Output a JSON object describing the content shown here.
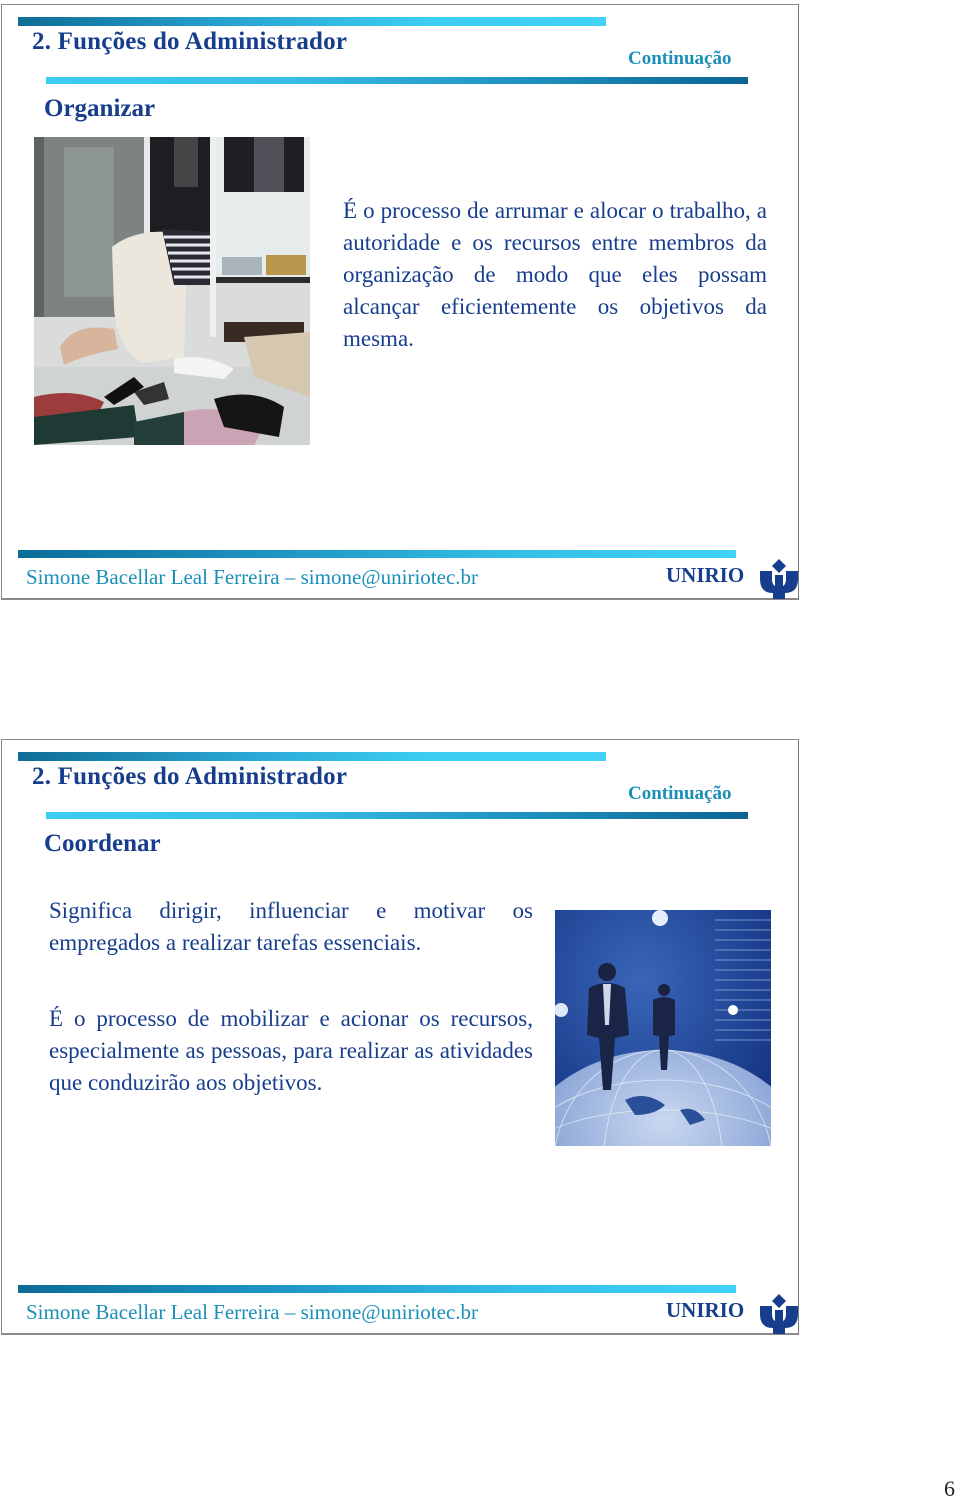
{
  "page": {
    "number": "6"
  },
  "slides": [
    {
      "title": "2. Funções do Administrador",
      "continuation": "Continuação",
      "subtitle": "Organizar",
      "paragraphs": [
        "É o processo de arrumar e alocar o trabalho, a autoridade e os recursos entre membros da organização de modo que eles possam alcançar eficientemente os objetivos da mesma."
      ],
      "image": {
        "description": "woman-searching-closet-with-shoes-photo"
      },
      "footer": {
        "author": "Simone Bacellar Leal Ferreira – simone@uniriotec.br",
        "institution": "UNIRIO",
        "logo": "unirio-logo-icon"
      }
    },
    {
      "title": "2. Funções do Administrador",
      "continuation": "Continuação",
      "subtitle": "Coordenar",
      "paragraphs": [
        "Significa dirigir, influenciar e motivar os empregados a realizar tarefas essenciais.",
        "É o processo de mobilizar e acionar os recursos, especialmente as pessoas, para realizar as atividades que conduzirão aos objetivos."
      ],
      "image": {
        "description": "businessmen-standing-on-globe-photo"
      },
      "footer": {
        "author": "Simone Bacellar Leal Ferreira – simone@uniriotec.br",
        "institution": "UNIRIO",
        "logo": "unirio-logo-icon"
      }
    }
  ],
  "colors": {
    "title": "#173e8c",
    "accent": "#1a8fb8",
    "bar_dark": "#0b6490",
    "bar_light": "#41d2f6"
  }
}
